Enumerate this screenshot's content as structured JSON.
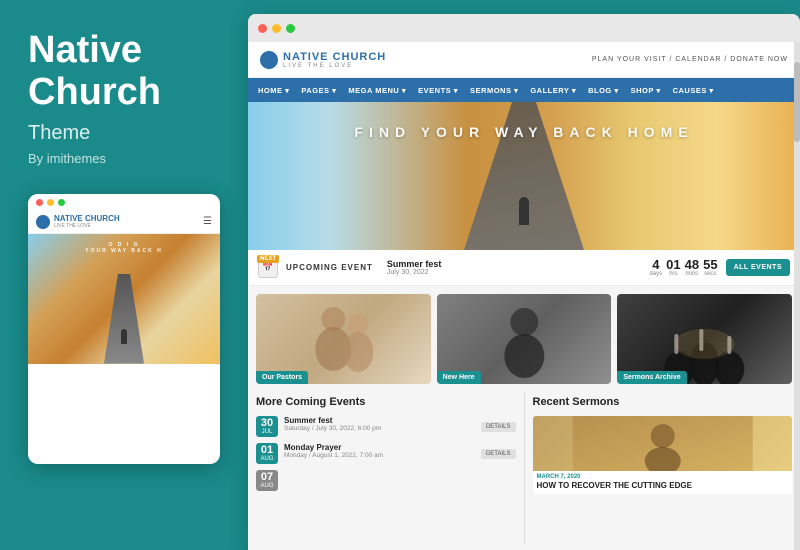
{
  "left": {
    "title_line1": "Native",
    "title_line2": "Church",
    "subtitle": "Theme",
    "author": "By imithemes"
  },
  "browser": {
    "site": {
      "logo_text": "NATIVE CHURCH",
      "logo_sub": "LIVE THE LOVE",
      "header_links": "PLAN YOUR VISIT / CALENDAR / DONATE NOW",
      "nav_items": [
        "HOME",
        "PAGES",
        "MEGA MENU",
        "EVENTS",
        "SERMONS",
        "GALLERY",
        "BLOG",
        "SHOP",
        "CAUSES"
      ],
      "hero_text": "FIND YOUR WAY BACK HOME",
      "events_bar": {
        "label": "NEXT",
        "upcoming": "UPCOMING EVENT",
        "event_name": "Summer fest",
        "event_date": "July 30, 2022",
        "countdown": {
          "days": "4",
          "hrs": "01",
          "mins": "48",
          "secs": "55"
        },
        "all_events_btn": "ALL EVENTS"
      },
      "cards": [
        {
          "label": "Our Pastors"
        },
        {
          "label": "New Here"
        },
        {
          "label": "Sermons Archive"
        }
      ],
      "more_events_heading": "More Coming Events",
      "events": [
        {
          "day": "30",
          "month": "JUL",
          "title": "Summer fest",
          "datetime": "Saturday / July 30, 2022, 6:00 pm",
          "details_btn": "DETAILS"
        },
        {
          "day": "01",
          "month": "AUG",
          "title": "Monday Prayer",
          "datetime": "Monday / August 1, 2022, 7:00 am",
          "details_btn": "DETAILS"
        },
        {
          "day": "07",
          "month": "AUG",
          "title": "",
          "datetime": "",
          "details_btn": ""
        }
      ],
      "recent_sermons_heading": "Recent Sermons",
      "sermon": {
        "date": "MARCH 7, 2020",
        "title": "HOW TO RECOVER THE CUTTING EDGE"
      }
    }
  },
  "mobile": {
    "logo_text": "NATIVE CHURCH",
    "logo_sub": "LIVE THE LOVE",
    "hero_text": "O D I G\nYOUR WAY BACK H"
  }
}
